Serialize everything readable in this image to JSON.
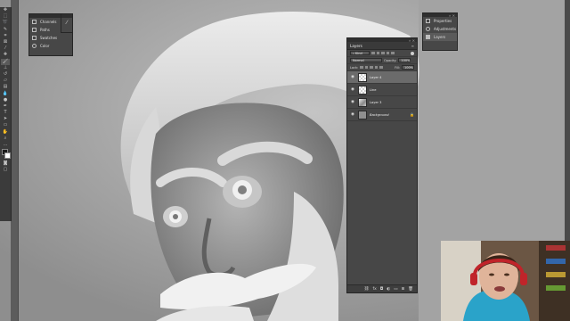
{
  "mini_panel": {
    "items": [
      {
        "label": "Channels",
        "icon": "channels-icon"
      },
      {
        "label": "Paths",
        "icon": "paths-icon"
      },
      {
        "label": "Swatches",
        "icon": "swatches-icon"
      },
      {
        "label": "Color",
        "icon": "color-icon"
      }
    ]
  },
  "right_dock": {
    "items": [
      {
        "label": "Properties",
        "icon": "properties-icon"
      },
      {
        "label": "Adjustments",
        "icon": "adjustments-icon"
      },
      {
        "label": "Layers",
        "icon": "layers-icon",
        "active": true
      }
    ]
  },
  "layers_panel": {
    "tab": "Layers",
    "filter_kind": "Kind",
    "blend_mode": "Normal",
    "opacity_label": "Opacity:",
    "opacity_value": "100%",
    "lock_label": "Lock:",
    "fill_label": "Fill:",
    "fill_value": "100%",
    "layers": [
      {
        "name": "Layer 4",
        "thumb": "checker",
        "selected": true,
        "visible": true
      },
      {
        "name": "Line",
        "thumb": "checker",
        "selected": false,
        "visible": true
      },
      {
        "name": "Layer 3",
        "thumb": "img",
        "selected": false,
        "visible": true
      },
      {
        "name": "Background",
        "thumb": "solid",
        "selected": false,
        "visible": true,
        "locked": true
      }
    ]
  },
  "colors": {
    "panel_bg": "#474747",
    "selected_layer": "#6b6b6b",
    "canvas_bg": "#a9a9a9"
  }
}
